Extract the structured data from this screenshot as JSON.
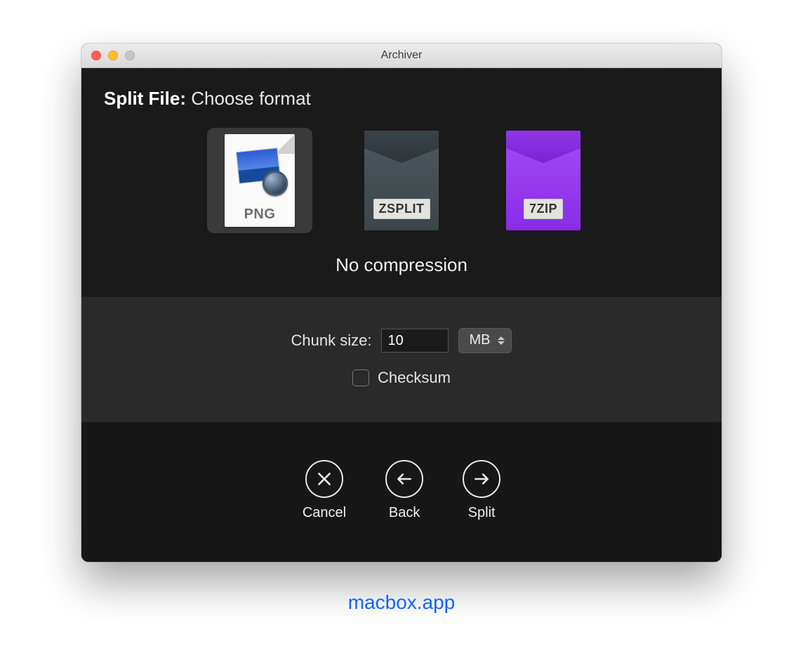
{
  "window": {
    "title": "Archiver"
  },
  "heading": {
    "prefix": "Split File:",
    "subtitle": "Choose format"
  },
  "formats": {
    "selected_index": 0,
    "items": [
      {
        "label": "PNG"
      },
      {
        "label": "ZSPLIT"
      },
      {
        "label": "7ZIP"
      }
    ]
  },
  "compression_label": "No compression",
  "chunk": {
    "label": "Chunk size:",
    "value": "10",
    "unit": "MB"
  },
  "checksum": {
    "label": "Checksum",
    "checked": false
  },
  "actions": {
    "cancel": "Cancel",
    "back": "Back",
    "split": "Split"
  },
  "watermark": "macbox.app"
}
